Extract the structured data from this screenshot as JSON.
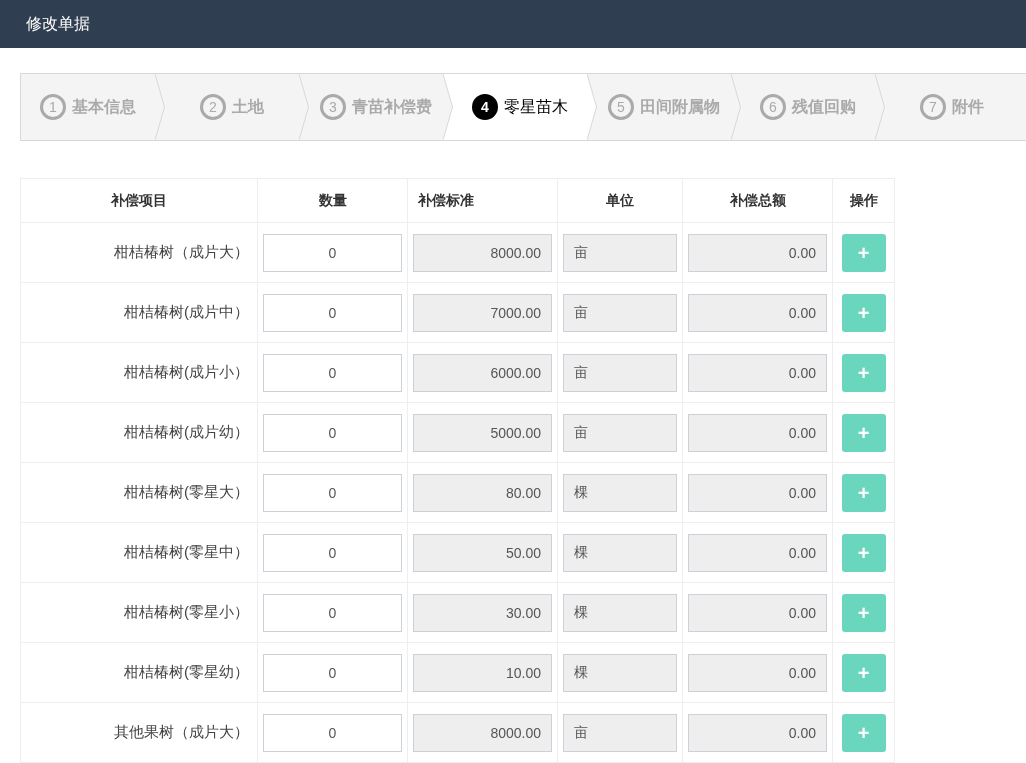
{
  "window": {
    "title": "修改单据"
  },
  "steps": [
    {
      "number": "1",
      "label": "基本信息",
      "selected": false
    },
    {
      "number": "2",
      "label": "土地",
      "selected": false
    },
    {
      "number": "3",
      "label": "青苗补偿费",
      "selected": false
    },
    {
      "number": "4",
      "label": "零星苗木",
      "selected": true
    },
    {
      "number": "5",
      "label": "田间附属物",
      "selected": false
    },
    {
      "number": "6",
      "label": "残值回购",
      "selected": false
    },
    {
      "number": "7",
      "label": "附件",
      "selected": false
    }
  ],
  "table": {
    "columns": [
      "补偿项目",
      "数量",
      "补偿标准",
      "单位",
      "补偿总额",
      "操作"
    ],
    "rows": [
      {
        "item": "柑桔椿树（成片大）",
        "quantity": "0",
        "standard": "8000.00",
        "unit": "亩",
        "total": "0.00",
        "action": "+"
      },
      {
        "item": "柑桔椿树(成片中）",
        "quantity": "0",
        "standard": "7000.00",
        "unit": "亩",
        "total": "0.00",
        "action": "+"
      },
      {
        "item": "柑桔椿树(成片小）",
        "quantity": "0",
        "standard": "6000.00",
        "unit": "亩",
        "total": "0.00",
        "action": "+"
      },
      {
        "item": "柑桔椿树(成片幼）",
        "quantity": "0",
        "standard": "5000.00",
        "unit": "亩",
        "total": "0.00",
        "action": "+"
      },
      {
        "item": "柑桔椿树(零星大）",
        "quantity": "0",
        "standard": "80.00",
        "unit": "棵",
        "total": "0.00",
        "action": "+"
      },
      {
        "item": "柑桔椿树(零星中）",
        "quantity": "0",
        "standard": "50.00",
        "unit": "棵",
        "total": "0.00",
        "action": "+"
      },
      {
        "item": "柑桔椿树(零星小）",
        "quantity": "0",
        "standard": "30.00",
        "unit": "棵",
        "total": "0.00",
        "action": "+"
      },
      {
        "item": "柑桔椿树(零星幼）",
        "quantity": "0",
        "standard": "10.00",
        "unit": "棵",
        "total": "0.00",
        "action": "+"
      },
      {
        "item": "其他果树（成片大）",
        "quantity": "0",
        "standard": "8000.00",
        "unit": "亩",
        "total": "0.00",
        "action": "+"
      }
    ]
  }
}
